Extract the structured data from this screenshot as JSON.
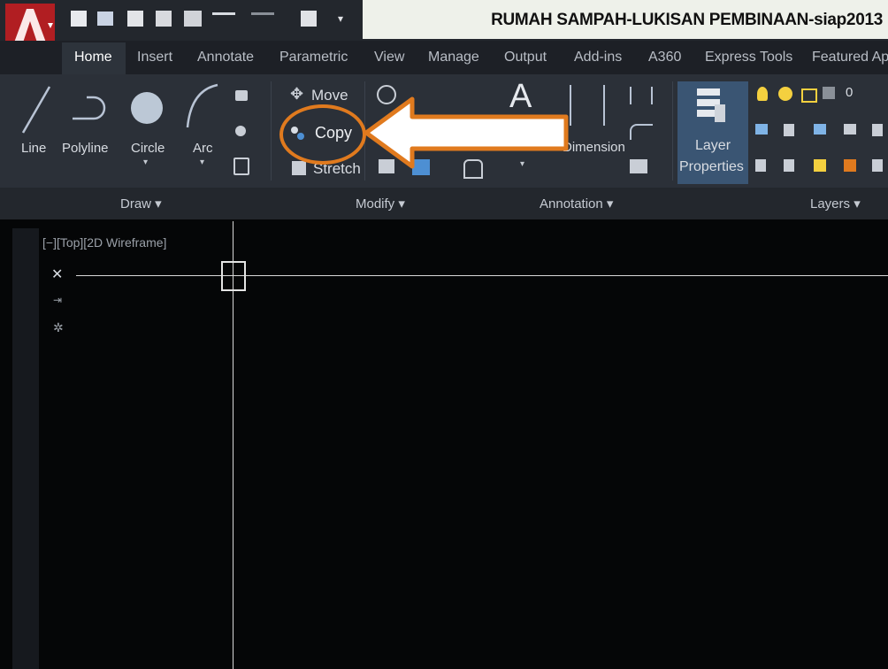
{
  "title": "RUMAH SAMPAH-LUKISAN PEMBINAAN-siap2013",
  "tabs": [
    "Home",
    "Insert",
    "Annotate",
    "Parametric",
    "View",
    "Manage",
    "Output",
    "Add-ins",
    "A360",
    "Express Tools",
    "Featured Apps"
  ],
  "draw": {
    "line": "Line",
    "polyline": "Polyline",
    "circle": "Circle",
    "arc": "Arc",
    "panel": "Draw ▾"
  },
  "modify": {
    "move": "Move",
    "copy": "Copy",
    "stretch": "Stretch",
    "panel": "Modify ▾"
  },
  "annotation": {
    "text": "A",
    "dimension": "Dimension",
    "panel": "Annotation ▾"
  },
  "layers": {
    "layer_properties_line1": "Layer",
    "layer_properties_line2": "Properties",
    "panel": "Layers ▾",
    "layer_value": "0"
  },
  "viewport": {
    "label": "[−][Top][2D Wireframe]"
  },
  "colors": {
    "highlight": "#e07a1e",
    "app_red": "#b11e22"
  }
}
